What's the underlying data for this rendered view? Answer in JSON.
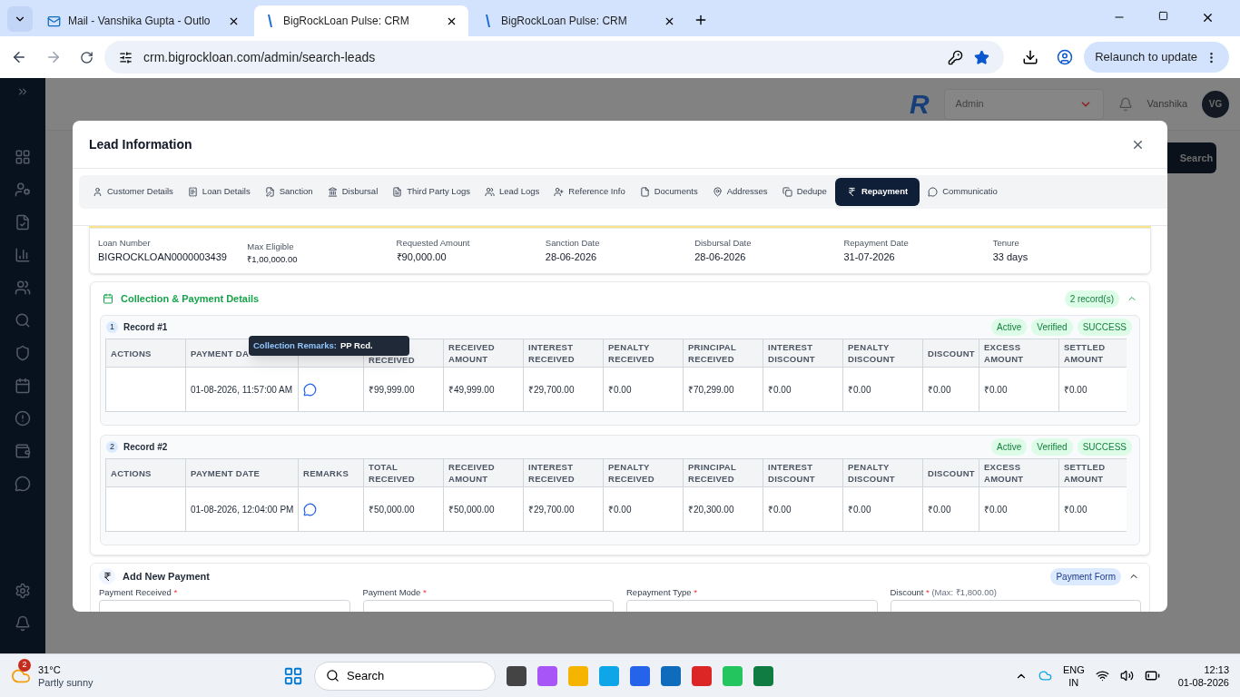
{
  "browser": {
    "tabs": [
      {
        "title": "Mail - Vanshika Gupta - Outlo",
        "kind": "mail",
        "selected": false
      },
      {
        "title": "BigRockLoan Pulse: CRM",
        "kind": "crm",
        "selected": true
      },
      {
        "title": "BigRockLoan Pulse: CRM",
        "kind": "crm",
        "selected": false
      }
    ],
    "url": "crm.bigrockloan.com/admin/search-leads",
    "relaunch": "Relaunch to update"
  },
  "app": {
    "logo": "R",
    "role": "Admin",
    "user": "Vanshika",
    "avatar": "VG",
    "search_button": "Search"
  },
  "modal": {
    "title": "Lead Information",
    "tabs": [
      {
        "label": "Customer Details",
        "selected": false
      },
      {
        "label": "Loan Details",
        "selected": false
      },
      {
        "label": "Sanction",
        "selected": false
      },
      {
        "label": "Disbursal",
        "selected": false
      },
      {
        "label": "Third Party Logs",
        "selected": false
      },
      {
        "label": "Lead Logs",
        "selected": false
      },
      {
        "label": "Reference Info",
        "selected": false
      },
      {
        "label": "Documents",
        "selected": false
      },
      {
        "label": "Addresses",
        "selected": false
      },
      {
        "label": "Dedupe",
        "selected": false
      },
      {
        "label": "Repayment",
        "selected": true
      },
      {
        "label": "Communicatio",
        "selected": false
      }
    ],
    "summary": [
      {
        "label": "Loan Number",
        "value": "BIGROCKLOAN0000003439",
        "kind": "main"
      },
      {
        "label": "Max Eligible",
        "value": "₹1,00,000.00",
        "kind": "minor"
      },
      {
        "label": "Requested Amount",
        "value": "₹90,000.00",
        "kind": "main"
      },
      {
        "label": "Sanction Date",
        "value": "28-06-2026",
        "kind": "main"
      },
      {
        "label": "Disbursal Date",
        "value": "28-06-2026",
        "kind": "main"
      },
      {
        "label": "Repayment Date",
        "value": "31-07-2026",
        "kind": "main"
      },
      {
        "label": "Tenure",
        "value": "33 days",
        "kind": "main"
      }
    ],
    "collection": {
      "title": "Collection & Payment Details",
      "count": "2 record(s)",
      "expanded": true,
      "records": [
        {
          "number": "1",
          "title": "Record #1",
          "badges": [
            "Active",
            "Verified",
            "SUCCESS"
          ],
          "tooltip": {
            "label": "Collection Remarks:",
            "text": "PP Rcd."
          },
          "columns": [
            {
              "label": "ACTIONS"
            },
            {
              "label": "PAYMENT DA"
            },
            {},
            {
              "label": "RECEIVED",
              "kind": "partial"
            },
            {
              "label": "RECEIVED AMOUNT"
            },
            {
              "label": "INTEREST RECEIVED"
            },
            {
              "label": "PENALTY RECEIVED"
            },
            {
              "label": "PRINCIPAL RECEIVED"
            },
            {
              "label": "INTEREST DISCOUNT"
            },
            {
              "label": "PENALTY DISCOUNT"
            },
            {
              "label": "DISCOUNT"
            },
            {
              "label": "EXCESS AMOUNT"
            },
            {
              "label": "SETTLED AMOUNT"
            }
          ],
          "cells": [
            {
              "kind": "empty"
            },
            {
              "kind": "text",
              "text": "01-08-2026, 11:57:00 AM"
            },
            {
              "kind": "remarks"
            },
            {
              "kind": "text",
              "text": "₹99,999.00"
            },
            {
              "kind": "text",
              "text": "₹49,999.00"
            },
            {
              "kind": "text",
              "text": "₹29,700.00"
            },
            {
              "kind": "text",
              "text": "₹0.00"
            },
            {
              "kind": "text",
              "text": "₹70,299.00"
            },
            {
              "kind": "text",
              "text": "₹0.00"
            },
            {
              "kind": "text",
              "text": "₹0.00"
            },
            {
              "kind": "text",
              "text": "₹0.00"
            },
            {
              "kind": "text",
              "text": "₹0.00"
            },
            {
              "kind": "text",
              "text": "₹0.00"
            }
          ]
        },
        {
          "number": "2",
          "title": "Record #2",
          "badges": [
            "Active",
            "Verified",
            "SUCCESS"
          ],
          "columns": [
            {
              "label": "ACTIONS"
            },
            {
              "label": "PAYMENT DATE"
            },
            {
              "label": "REMARKS"
            },
            {
              "label": "TOTAL RECEIVED"
            },
            {
              "label": "RECEIVED AMOUNT"
            },
            {
              "label": "INTEREST RECEIVED"
            },
            {
              "label": "PENALTY RECEIVED"
            },
            {
              "label": "PRINCIPAL RECEIVED"
            },
            {
              "label": "INTEREST DISCOUNT"
            },
            {
              "label": "PENALTY DISCOUNT"
            },
            {
              "label": "DISCOUNT"
            },
            {
              "label": "EXCESS AMOUNT"
            },
            {
              "label": "SETTLED AMOUNT"
            }
          ],
          "cells": [
            {
              "kind": "empty"
            },
            {
              "kind": "text",
              "text": "01-08-2026, 12:04:00 PM"
            },
            {
              "kind": "remarks"
            },
            {
              "kind": "text",
              "text": "₹50,000.00"
            },
            {
              "kind": "text",
              "text": "₹50,000.00"
            },
            {
              "kind": "text",
              "text": "₹29,700.00"
            },
            {
              "kind": "text",
              "text": "₹0.00"
            },
            {
              "kind": "text",
              "text": "₹20,300.00"
            },
            {
              "kind": "text",
              "text": "₹0.00"
            },
            {
              "kind": "text",
              "text": "₹0.00"
            },
            {
              "kind": "text",
              "text": "₹0.00"
            },
            {
              "kind": "text",
              "text": "₹0.00"
            },
            {
              "kind": "text",
              "text": "₹0.00"
            }
          ]
        }
      ]
    },
    "add_payment": {
      "title": "Add New Payment",
      "badge": "Payment Form",
      "expanded": true,
      "required_mark": "*",
      "fields": [
        {
          "label": "Payment Received",
          "required": true
        },
        {
          "label": "Payment Mode",
          "required": true
        },
        {
          "label": "Repayment Type",
          "required": true
        },
        {
          "label": "Discount",
          "required": true,
          "hint": "(Max: ₹1,800.00)"
        }
      ]
    }
  },
  "taskbar": {
    "weather": {
      "temp": "31°C",
      "text": "Partly sunny",
      "badge": "2"
    },
    "search": "Search",
    "lang": "ENG",
    "region": "IN",
    "time": "12:13",
    "date": "01-08-2026"
  }
}
